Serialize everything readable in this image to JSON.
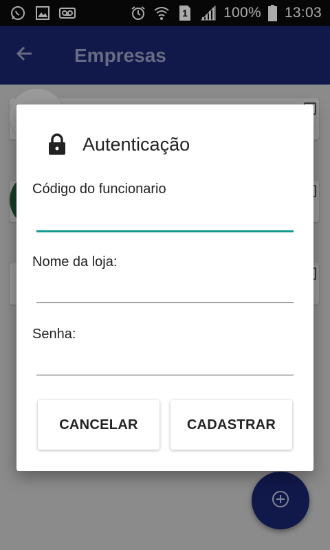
{
  "status_bar": {
    "battery_percent": "100%",
    "time": "13:03",
    "sim_slot": "1",
    "icons": [
      "whatsapp-icon",
      "image-icon",
      "voicemail-icon",
      "alarm-icon",
      "wifi-icon",
      "sim-icon",
      "signal-icon",
      "battery-icon"
    ]
  },
  "app_bar": {
    "title": "Empresas",
    "back_icon": "arrow-left-icon"
  },
  "dialog": {
    "title": "Autenticação",
    "icon": "lock-icon",
    "fields": [
      {
        "label": "Código do funcionario",
        "value": "",
        "focused": true
      },
      {
        "label": "Nome da loja:",
        "value": "",
        "focused": false
      },
      {
        "label": "Senha:",
        "value": "",
        "focused": false
      }
    ],
    "buttons": {
      "cancel": "CANCELAR",
      "submit": "CADASTRAR"
    }
  },
  "fab": {
    "icon": "add-circle-icon"
  },
  "colors": {
    "primary": "#1a2670",
    "accent": "#14998c",
    "status_bar": "#0b0b0b"
  }
}
